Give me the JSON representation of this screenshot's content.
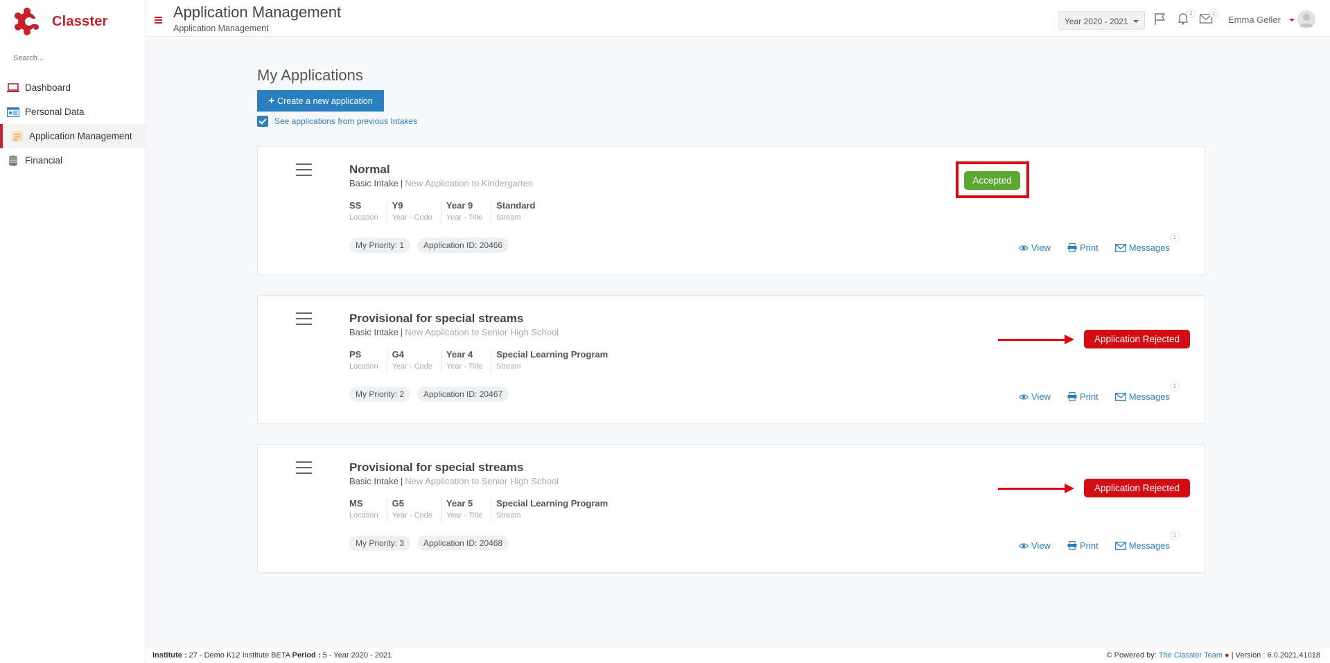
{
  "brand": {
    "name": "Classter",
    "accent": "#c4212c",
    "primary": "#2a7fc1"
  },
  "sidebar": {
    "search_placeholder": "Search...",
    "items": [
      {
        "label": "Dashboard",
        "icon": "laptop-icon"
      },
      {
        "label": "Personal Data",
        "icon": "id-card-icon"
      },
      {
        "label": "Application Management",
        "icon": "forms-icon",
        "active": true
      },
      {
        "label": "Financial",
        "icon": "coins-icon"
      }
    ]
  },
  "header": {
    "title": "Application Management",
    "subtitle": "Application Management",
    "year": "Year 2020 - 2021",
    "notifications_count": "1",
    "messages_count": "1",
    "user_name": "Emma Geller"
  },
  "main": {
    "title": "My Applications",
    "create_label": "Create a new application",
    "previous_intakes_label": "See applications from previous Intakes",
    "applications": [
      {
        "title": "Normal",
        "intake": "Basic Intake",
        "description": "New Application to Kindergarten",
        "attrs": [
          {
            "value": "SS",
            "label": "Location"
          },
          {
            "value": "Y9",
            "label": "Year - Code"
          },
          {
            "value": "Year 9",
            "label": "Year - Title"
          },
          {
            "value": "Standard",
            "label": "Stream"
          }
        ],
        "priority": "My Priority: 1",
        "app_id": "Application ID: 20466",
        "status": "Accepted",
        "status_color": "#5aa832"
      },
      {
        "title": "Provisional for special streams",
        "intake": "Basic Intake",
        "description": "New Application to Senior High School",
        "attrs": [
          {
            "value": "PS",
            "label": "Location"
          },
          {
            "value": "G4",
            "label": "Year - Code"
          },
          {
            "value": "Year 4",
            "label": "Year - Title"
          },
          {
            "value": "Special Learning Program",
            "label": "Stream"
          }
        ],
        "priority": "My Priority: 2",
        "app_id": "Application ID: 20467",
        "status": "Application Rejected",
        "status_color": "#d40d14"
      },
      {
        "title": "Provisional for special streams",
        "intake": "Basic Intake",
        "description": "New Application to Senior High School",
        "attrs": [
          {
            "value": "MS",
            "label": "Location"
          },
          {
            "value": "G5",
            "label": "Year - Code"
          },
          {
            "value": "Year 5",
            "label": "Year - Title"
          },
          {
            "value": "Special Learning Program",
            "label": "Stream"
          }
        ],
        "priority": "My Priority: 3",
        "app_id": "Application ID: 20468",
        "status": "Application Rejected",
        "status_color": "#d40d14"
      }
    ],
    "actions": {
      "view": "View",
      "print": "Print",
      "messages": "Messages",
      "messages_badge": "1"
    }
  },
  "footer": {
    "institute_label": "Institute :",
    "institute_value": "27 - Demo K12 Institute BETA",
    "period_label": "Period :",
    "period_value": "5 - Year 2020 - 2021",
    "powered_label": "Powered by:",
    "powered_link": "The Classter Team",
    "version": "| Version : 6.0.2021.41018"
  }
}
